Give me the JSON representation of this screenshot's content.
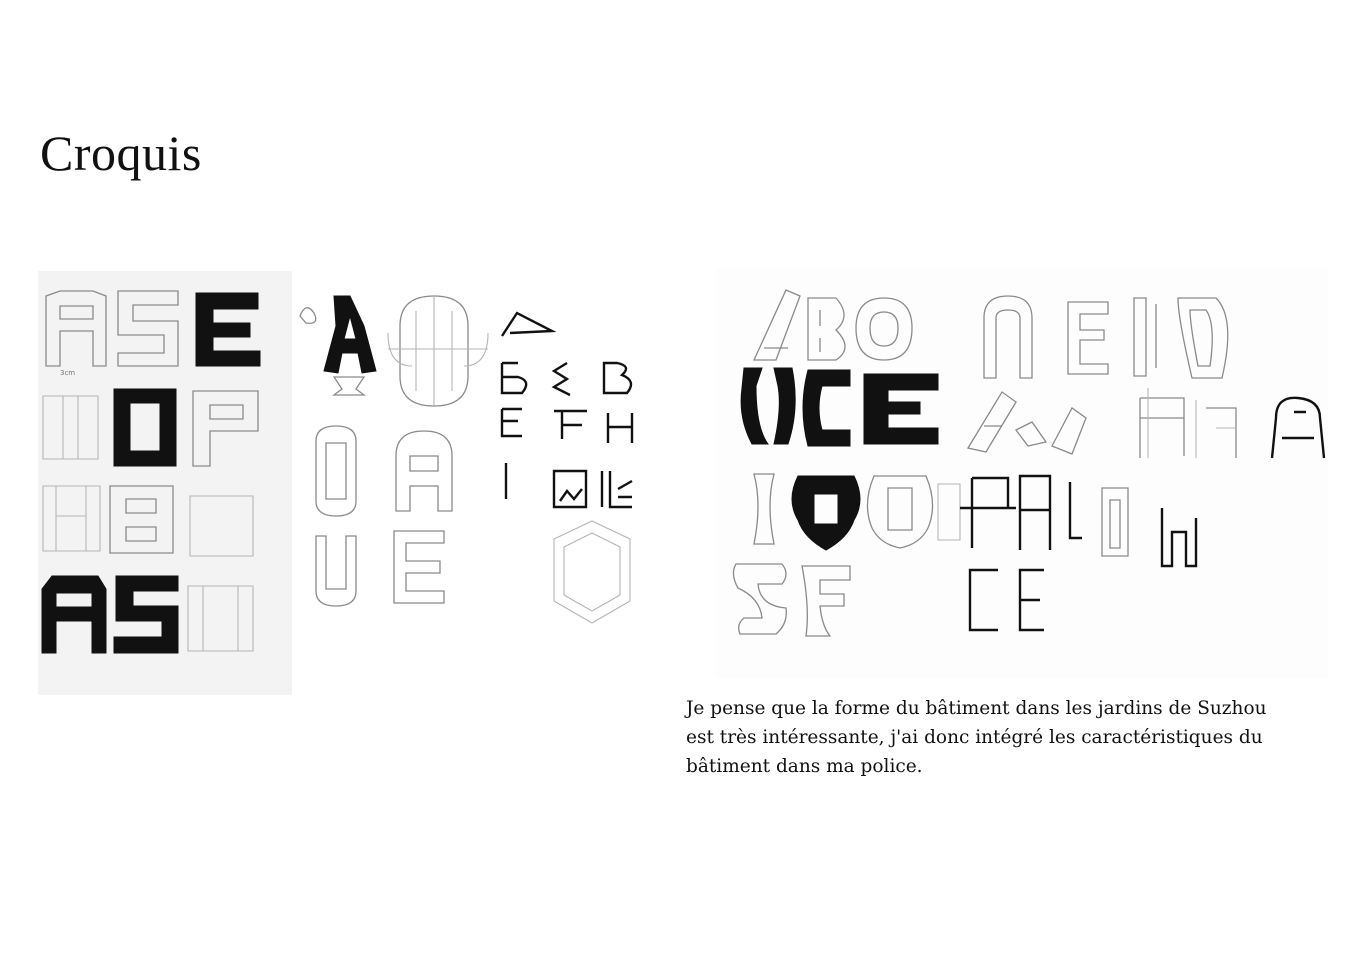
{
  "page": {
    "title": "Croquis",
    "caption_lines": [
      "Je pense que la forme du bâtiment dans les jardins de Suzhou",
      "est très intéressante, j'ai donc intégré les caractéristiques du",
      "bâtiment dans ma police."
    ]
  },
  "sketches": {
    "left_sheet_label": "3cm"
  }
}
